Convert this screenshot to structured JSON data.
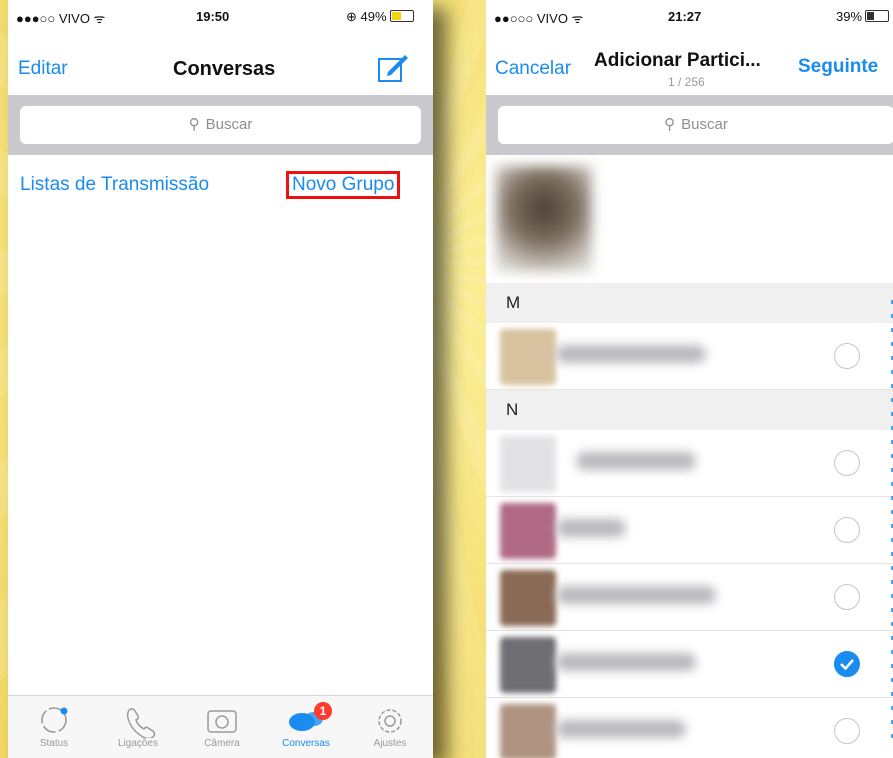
{
  "left": {
    "status": {
      "carrier": "●●●○○ VIVO ᯤ",
      "time": "19:50",
      "battery": "⊕ 49%"
    },
    "nav": {
      "edit": "Editar",
      "title": "Conversas",
      "compose_icon": "compose-icon"
    },
    "search_placeholder": "Buscar",
    "broadcast_link": "Listas de Transmissão",
    "new_group_link": "Novo Grupo",
    "tabs": [
      {
        "label": "Status",
        "icon": "status-icon"
      },
      {
        "label": "Ligações",
        "icon": "phone-icon"
      },
      {
        "label": "Câmera",
        "icon": "camera-icon"
      },
      {
        "label": "Conversas",
        "icon": "chats-icon",
        "badge": "1"
      },
      {
        "label": "Ajustes",
        "icon": "gear-icon"
      }
    ]
  },
  "right": {
    "status": {
      "carrier": "●●○○○ VIVO ᯤ",
      "time": "21:27",
      "battery": "39%"
    },
    "nav": {
      "cancel": "Cancelar",
      "title": "Adicionar Partici...",
      "subtitle": "1 / 256",
      "next": "Seguinte"
    },
    "search_placeholder": "Buscar",
    "sections": [
      "M",
      "N"
    ],
    "contacts_checked": [
      false,
      false,
      false,
      false,
      true,
      false
    ]
  },
  "colors": {
    "accent": "#1a8cf0",
    "highlight": "#e11111",
    "badge": "#ff3b30"
  }
}
